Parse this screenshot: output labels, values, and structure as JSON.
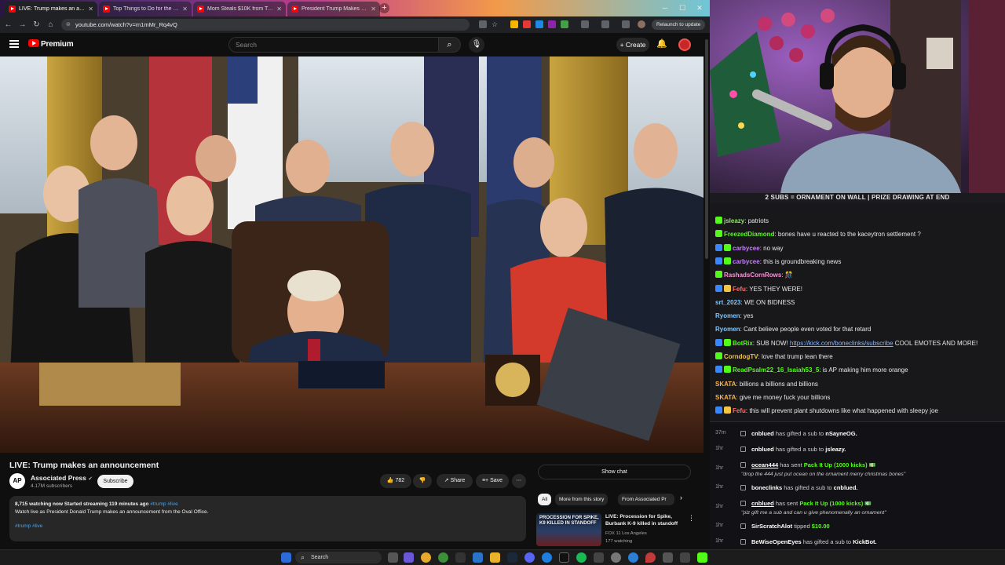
{
  "browser": {
    "tabs": [
      {
        "title": "LIVE: Trump makes an anno",
        "active": true
      },
      {
        "title": "Top Things to Do for the HOLIDAYS",
        "active": false
      },
      {
        "title": "Mom Steals $10K from Target to",
        "active": false
      },
      {
        "title": "President Trump Makes an Ann",
        "active": false
      }
    ],
    "url": "youtube.com/watch?v=m1mMr_Rq4vQ",
    "relaunch_label": "Relaunch to update"
  },
  "youtube": {
    "logo_text": "Premium",
    "search_placeholder": "Search",
    "create_label": "Create",
    "video": {
      "title": "LIVE: Trump makes an announcement",
      "channel": "Associated Press",
      "channel_avatar_text": "AP",
      "subscribers": "4.17M subscribers",
      "subscribe_label": "Subscribe",
      "likes": "782",
      "share_label": "Share",
      "save_label": "Save",
      "description": {
        "stats": "8,715 watching now  Started streaming 119 minutes ago",
        "stat_tags": "#trump #live",
        "text": "Watch live as President Donald Trump makes an announcement from the Oval Office.",
        "tags": "#trump #live"
      }
    },
    "sidebar": {
      "show_chat_label": "Show chat",
      "chips": [
        {
          "label": "All",
          "selected": true
        },
        {
          "label": "More from this story",
          "selected": false
        },
        {
          "label": "From Associated Pr",
          "selected": false
        }
      ],
      "related": {
        "thumb_text": "PROCESSION FOR SPIKE, K9 KILLED IN STANDOFF",
        "title": "LIVE: Procession for Spike, Burbank K-9 killed in standoff",
        "channel": "FOX 11 Los Angeles",
        "watching": "177 watching"
      }
    }
  },
  "stream": {
    "banner": "2 SUBS = ORNAMENT ON WALL | PRIZE DRAWING AT END"
  },
  "chat": [
    {
      "user": "jsleazy",
      "color": "#93e36b",
      "text": "patriots",
      "badges": [
        "#53fc18"
      ]
    },
    {
      "user": "FreezedDiamond",
      "color": "#53fc18",
      "text": "bones have u reacted to the kaceytron settlement ?",
      "badges": [
        "#53fc18"
      ]
    },
    {
      "user": "carbycee",
      "color": "#c77dff",
      "text": "no way",
      "badges": [
        "#3a86ff",
        "#53fc18"
      ]
    },
    {
      "user": "carbycee",
      "color": "#c77dff",
      "text": "this is groundbreaking news",
      "badges": [
        "#3a86ff",
        "#53fc18"
      ]
    },
    {
      "user": "RashadsCornRows",
      "color": "#ff8fd8",
      "text": "🎊",
      "badges": [
        "#53fc18"
      ]
    },
    {
      "user": "Fefu",
      "color": "#ff6b6b",
      "text": "YES THEY WERE!",
      "badges": [
        "#3a86ff",
        "#f4c542"
      ]
    },
    {
      "user": "srt_2023",
      "color": "#7ec8ff",
      "text": "WE ON BIDNESS",
      "badges": []
    },
    {
      "user": "Ryomen",
      "color": "#7ec8ff",
      "text": "yes",
      "badges": []
    },
    {
      "user": "Ryomen",
      "color": "#7ec8ff",
      "text": "Cant believe people even voted for that retard",
      "badges": []
    },
    {
      "user": "BotRix",
      "color": "#53fc18",
      "text_before": "SUB NOW! ",
      "link": "https://kick.com/boneclinks/subscribe",
      "text_after": " COOL EMOTES AND MORE!",
      "badges": [
        "#3a86ff",
        "#53fc18"
      ]
    },
    {
      "user": "CorndogTV",
      "color": "#f4c542",
      "text": "love that trump lean there",
      "badges": [
        "#53fc18"
      ]
    },
    {
      "user": "ReadPsalm22_16_Isaiah53_5",
      "color": "#53fc18",
      "text": "is AP making him more orange",
      "badges": [
        "#3a86ff",
        "#53fc18"
      ]
    },
    {
      "user": "SKATA",
      "color": "#ffb347",
      "text": "billions a billions and billions",
      "badges": []
    },
    {
      "user": "SKATA",
      "color": "#ffb347",
      "text": "give me money fuck your billions",
      "badges": []
    },
    {
      "user": "Fefu",
      "color": "#ff6b6b",
      "text": "this will prevent plant shutdowns like what happened with sleepy joe",
      "badges": [
        "#3a86ff",
        "#f4c542"
      ]
    }
  ],
  "feed": [
    {
      "time": "37m",
      "user": "cnblued",
      "text": "has gifted a sub to",
      "target": "nSayneOG."
    },
    {
      "time": "1hr",
      "user": "cnblued",
      "text": "has gifted a sub to",
      "target": "jsleazy."
    },
    {
      "time": "1hr",
      "user": "ocean444",
      "text": "has sent",
      "sound": "Pack It Up (1000 kicks)",
      "quote": "\"drop the 444 just put ocean on the ornament merry christmas bones\""
    },
    {
      "time": "1hr",
      "user": "boneclinks",
      "text": "has gifted a sub to",
      "target": "cnblued."
    },
    {
      "time": "1hr",
      "user": "cnblued",
      "text": "has sent",
      "sound": "Pack It Up (1000 kicks)",
      "quote": "\"plz gift me a sub and can u give phenomenally an ornament\""
    },
    {
      "time": "1hr",
      "user": "SirScratchAlot",
      "text": "tipped",
      "amount": "$10.00"
    },
    {
      "time": "1hr",
      "user": "BeWiseOpenEyes",
      "text": "has gifted a sub to",
      "target": "KickBot."
    }
  ],
  "taskbar": {
    "search_label": "Search"
  },
  "colors": {
    "youtube_red": "#ff0000",
    "kick_green": "#53fc18",
    "link_blue": "#3ea6ff"
  }
}
